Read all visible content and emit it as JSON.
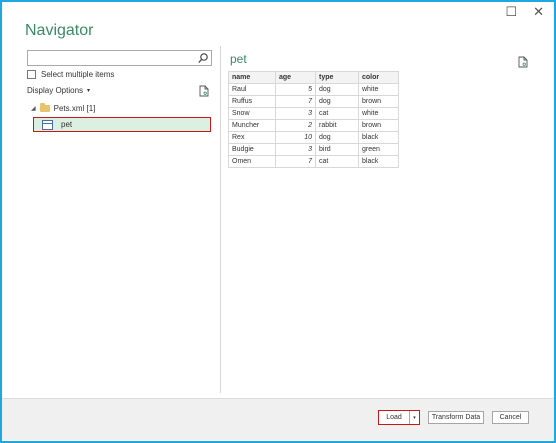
{
  "window": {
    "title": "Navigator",
    "restore_symbol": "☐",
    "close_symbol": "✕"
  },
  "left_pane": {
    "search": {
      "placeholder": "",
      "value": ""
    },
    "select_multiple_label": "Select multiple items",
    "display_options_label": "Display Options",
    "display_options_caret": "▾",
    "tree": {
      "root_label": "Pets.xml [1]",
      "items": [
        {
          "label": "pet",
          "selected": true
        }
      ]
    }
  },
  "preview": {
    "title": "pet",
    "columns": [
      "name",
      "age",
      "type",
      "color"
    ],
    "rows": [
      [
        "Raul",
        "5",
        "dog",
        "white"
      ],
      [
        "Ruffus",
        "7",
        "dog",
        "brown"
      ],
      [
        "Snow",
        "3",
        "cat",
        "white"
      ],
      [
        "Muncher",
        "2",
        "rabbit",
        "brown"
      ],
      [
        "Rex",
        "10",
        "dog",
        "black"
      ],
      [
        "Budgie",
        "3",
        "bird",
        "green"
      ],
      [
        "Omen",
        "7",
        "cat",
        "black"
      ]
    ]
  },
  "footer": {
    "load_label": "Load",
    "load_dropdown_symbol": "▾",
    "transform_label": "Transform Data",
    "cancel_label": "Cancel"
  },
  "colors": {
    "frame_border": "#1ea7e1",
    "title_green": "#3a8a63",
    "selection_bg": "#dcf0e2",
    "highlight_red": "#c8161d"
  },
  "icons": {
    "search": "search-icon",
    "file_preview": "file-preview-icon",
    "folder": "folder-icon",
    "table": "table-icon"
  }
}
